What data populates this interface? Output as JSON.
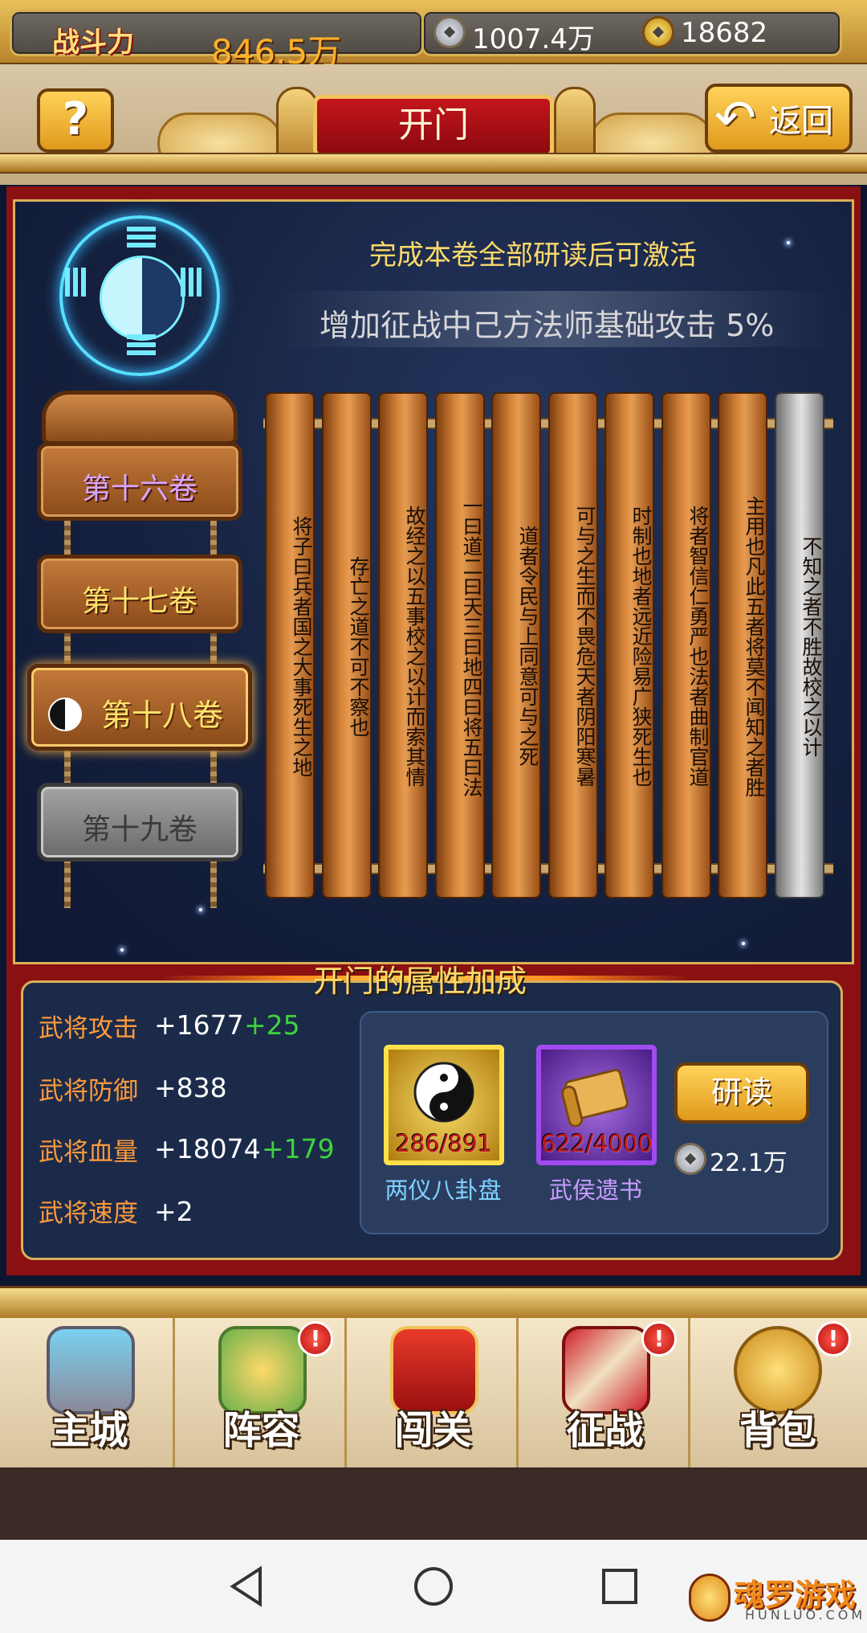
{
  "topbar": {
    "power_label": "战斗力",
    "power_value": "846.5万",
    "silver_value": "1007.4万",
    "gold_value": "18682"
  },
  "header": {
    "help_label": "?",
    "title": "开门",
    "back_label": "返回"
  },
  "volume_panel": {
    "unlock_hint": "完成本卷全部研读后可激活",
    "bonus_text": "增加征战中己方法师基础攻击 5%",
    "volumes": [
      {
        "label": "第十六卷",
        "state": "done"
      },
      {
        "label": "第十七卷",
        "state": "done"
      },
      {
        "label": "第十八卷",
        "state": "current"
      },
      {
        "label": "第十九卷",
        "state": "locked"
      }
    ],
    "slips": [
      "将子曰兵者国之大事死生之地",
      "存亡之道不可不察也",
      "故经之以五事校之以计而索其情",
      "一曰道二曰天三曰地四曰将五曰法",
      "道者令民与上同意可与之死",
      "可与之生而不畏危天者阴阳寒暑",
      "时制也地者远近险易广狭死生也",
      "将者智信仁勇严也法者曲制官道",
      "主用也凡此五者将莫不闻知之者胜",
      "不知之者不胜故校之以计"
    ]
  },
  "attributes": {
    "title": "开门的属性加成",
    "rows": [
      {
        "label": "武将攻击",
        "value": "+1677",
        "bonus": "+25"
      },
      {
        "label": "武将防御",
        "value": "+838",
        "bonus": ""
      },
      {
        "label": "武将血量",
        "value": "+18074",
        "bonus": "+179"
      },
      {
        "label": "武将速度",
        "value": "+2",
        "bonus": ""
      }
    ]
  },
  "materials": {
    "items": [
      {
        "name": "两仪八卦盘",
        "count": "286/891",
        "icon": "yin-yang-disc-icon",
        "name_color": "#7fd0ff"
      },
      {
        "name": "武侯遗书",
        "count": "622/4000",
        "icon": "scroll-book-icon",
        "name_color": "#c79cff"
      }
    ],
    "research_label": "研读",
    "cost": "22.1万"
  },
  "nav": {
    "items": [
      {
        "label": "主城",
        "icon": "castle-icon",
        "badge": ""
      },
      {
        "label": "阵容",
        "icon": "generals-icon",
        "badge": "!"
      },
      {
        "label": "闯关",
        "icon": "banner-scroll-icon",
        "badge": ""
      },
      {
        "label": "征战",
        "icon": "crossed-swords-icon",
        "badge": "!"
      },
      {
        "label": "背包",
        "icon": "treasure-bag-icon",
        "badge": "!"
      }
    ]
  },
  "watermark": {
    "text": "魂罗游戏",
    "sub": "HUNLUO.COM"
  },
  "colors": {
    "accent_gold": "#d8b056",
    "panel_red": "#8a1012",
    "attr_label": "#ff9b3a",
    "attr_bonus": "#3ed33e"
  }
}
